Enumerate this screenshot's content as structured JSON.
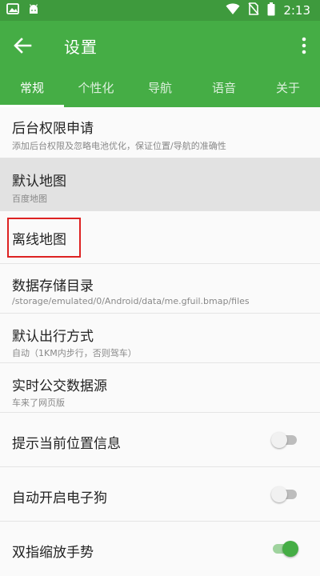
{
  "status_bar": {
    "icons_left": [
      "image-icon",
      "android-icon"
    ],
    "icons_right": [
      "wifi-icon",
      "no-sim-icon",
      "battery-icon"
    ],
    "time": "2:13"
  },
  "app_bar": {
    "title": "设置",
    "back_icon": "arrow-left-icon",
    "menu_icon": "more-vert-icon"
  },
  "tabs": [
    {
      "label": "常规",
      "active": true
    },
    {
      "label": "个性化",
      "active": false
    },
    {
      "label": "导航",
      "active": false
    },
    {
      "label": "语音",
      "active": false
    },
    {
      "label": "关于",
      "active": false
    }
  ],
  "settings": [
    {
      "title": "后台权限申请",
      "subtitle": "添加后台权限及忽略电池优化，保证位置/导航的准确性"
    },
    {
      "title": "默认地图",
      "subtitle": "百度地图",
      "selected": true
    },
    {
      "title": "离线地图",
      "highlighted": true
    },
    {
      "title": "数据存储目录",
      "subtitle": "/storage/emulated/0/Android/data/me.gfuil.bmap/files"
    },
    {
      "title": "默认出行方式",
      "subtitle": "自动（1KM内步行，否则驾车）"
    },
    {
      "title": "实时公交数据源",
      "subtitle": "车来了网页版"
    },
    {
      "title": "提示当前位置信息",
      "toggle": false
    },
    {
      "title": "自动开启电子狗",
      "toggle": false
    },
    {
      "title": "双指缩放手势",
      "toggle": true
    }
  ],
  "colors": {
    "status_bar": "#3e9a3d",
    "app_bar": "#45ad45",
    "highlight_box": "#dd2222",
    "selected_row": "#e2e2e2"
  }
}
